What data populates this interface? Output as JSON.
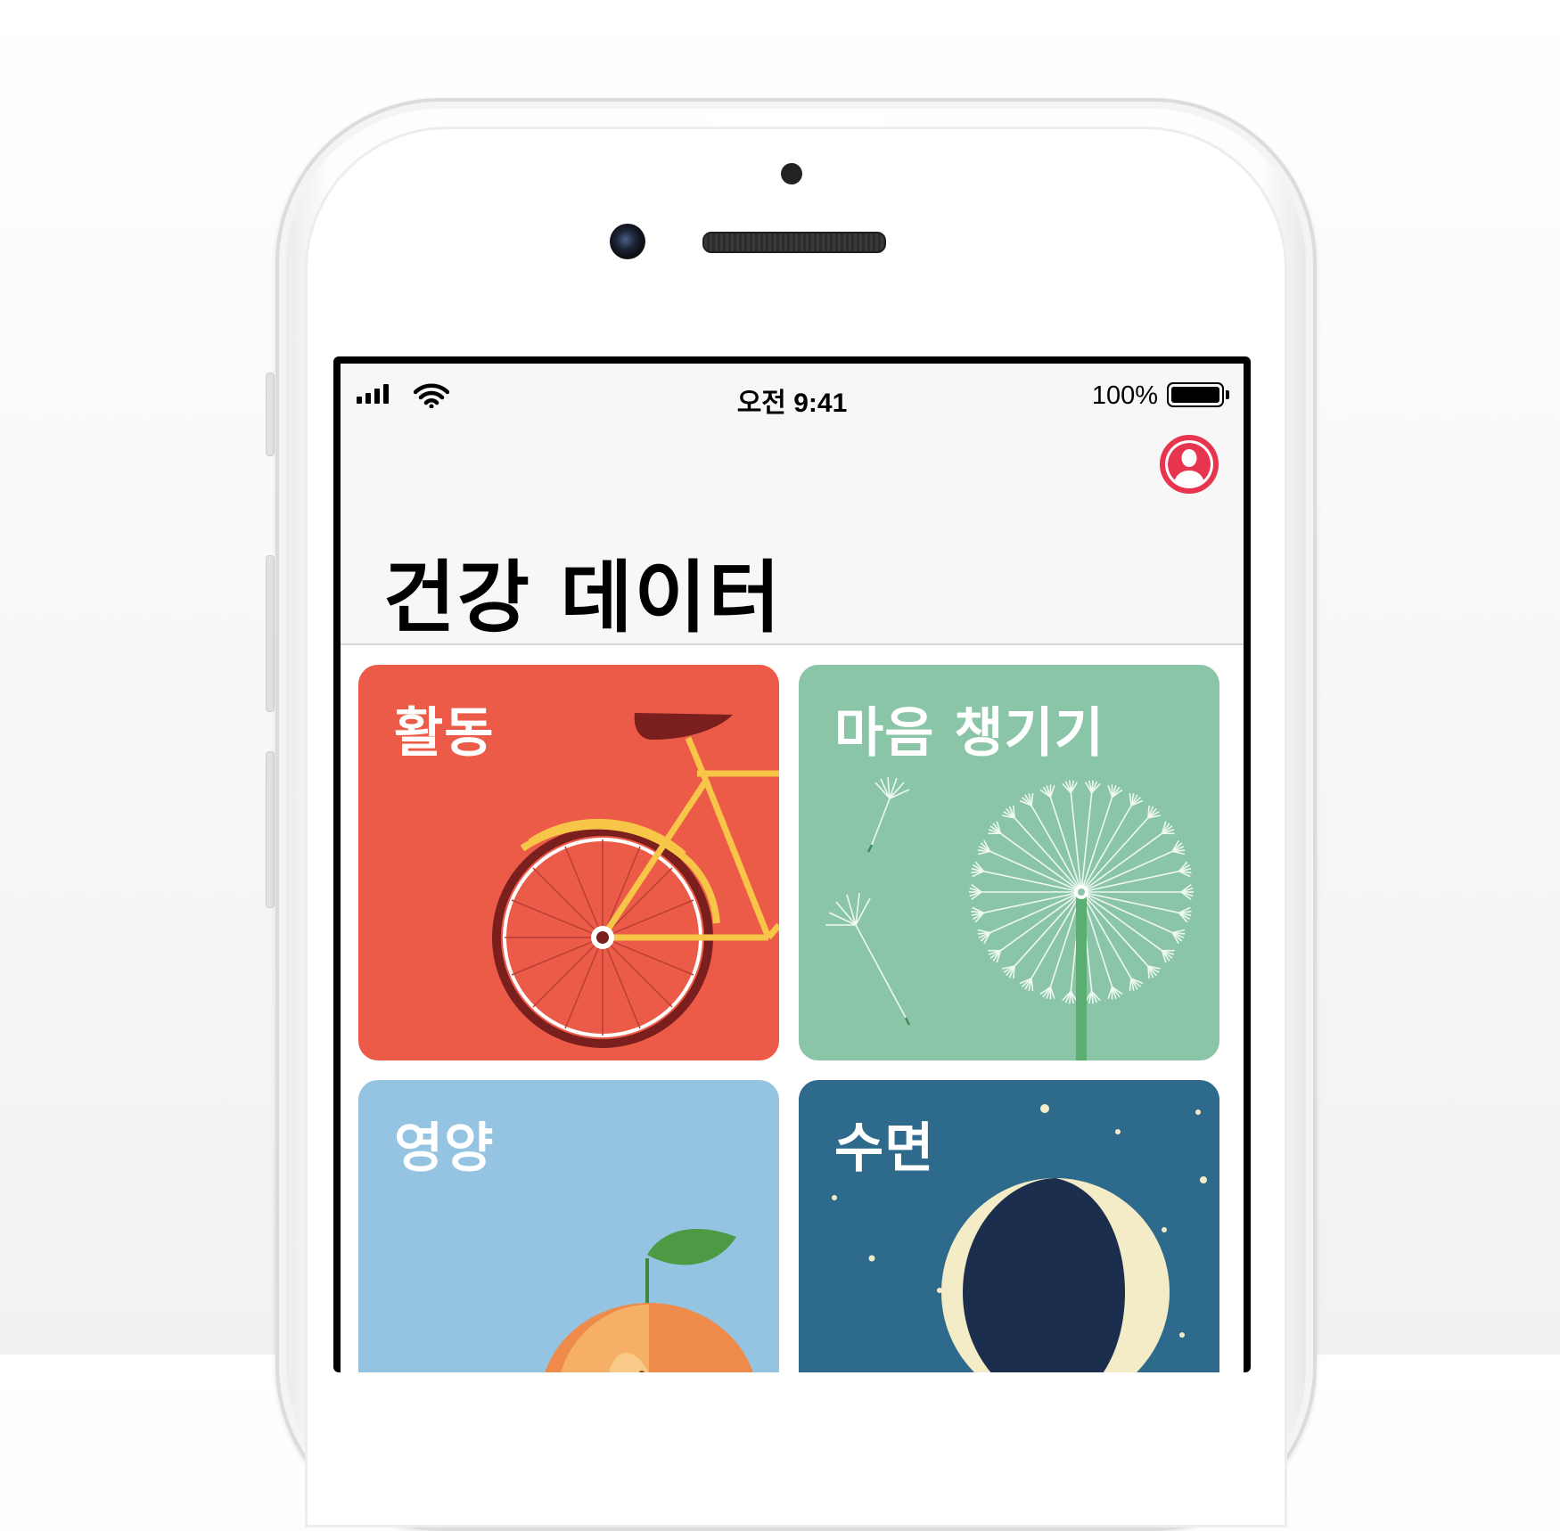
{
  "status_bar": {
    "time": "오전 9:41",
    "battery_percent": "100%",
    "signal_icon": "cellular-signal-icon",
    "wifi_icon": "wifi-icon",
    "battery_icon": "battery-icon",
    "battery_level": 1.0
  },
  "header": {
    "title": "건강 데이터",
    "profile_icon": "profile-icon"
  },
  "categories": [
    {
      "label": "활동",
      "color": "#ec5b47",
      "illustration": "bicycle-icon"
    },
    {
      "label": "마음 챙기기",
      "color": "#8bc5a8",
      "illustration": "dandelion-icon"
    },
    {
      "label": "영양",
      "color": "#94c4e2",
      "illustration": "peach-icon"
    },
    {
      "label": "수면",
      "color": "#2e6a8c",
      "illustration": "moon-icon"
    }
  ],
  "colors": {
    "accent_red": "#e8354f",
    "activity": "#ec5b47",
    "mindfulness": "#8bc5a8",
    "nutrition": "#94c4e2",
    "sleep": "#2e6a8c"
  }
}
